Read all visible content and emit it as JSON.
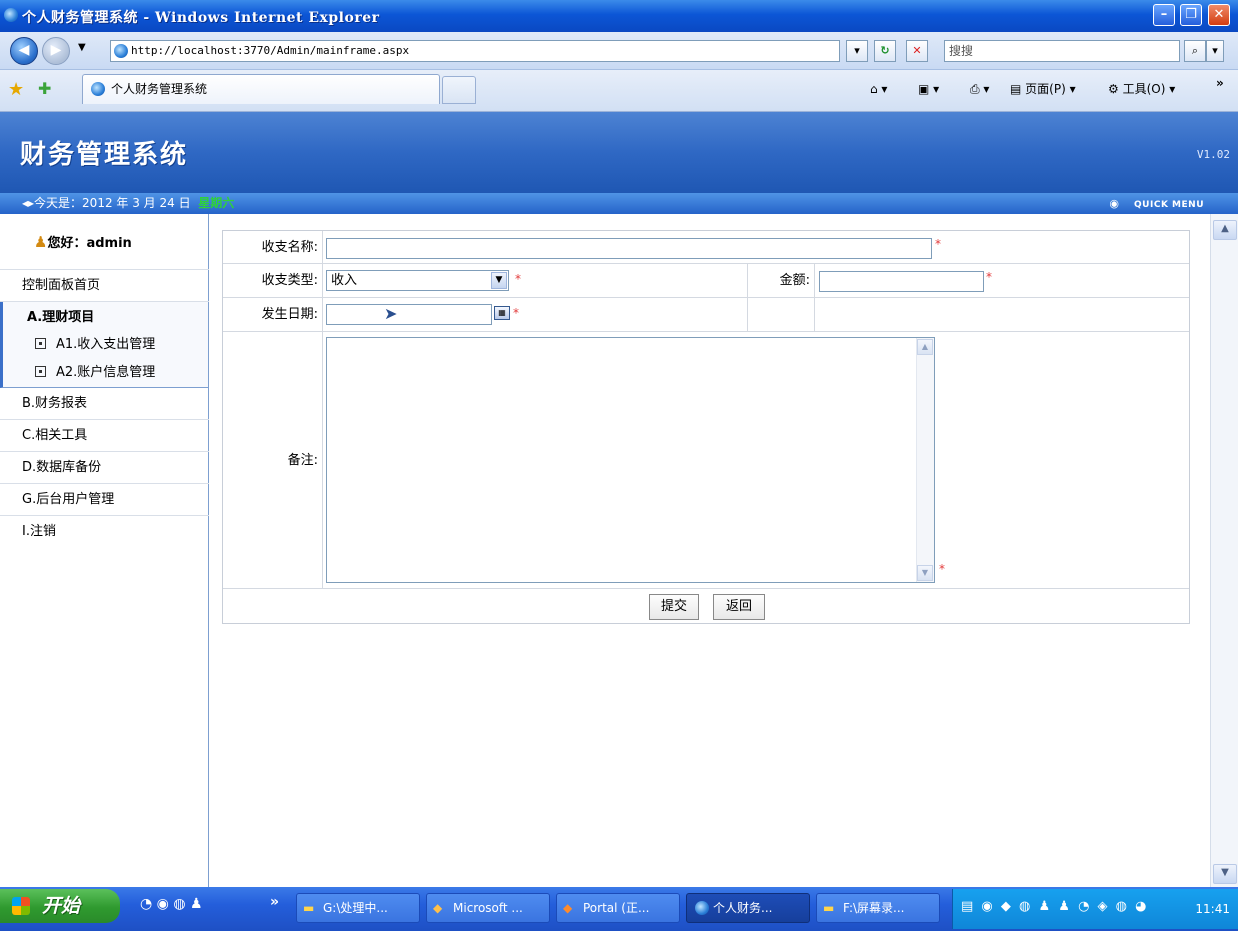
{
  "window": {
    "title": "个人财务管理系统 - Windows Internet Explorer"
  },
  "browser": {
    "url": "http://localhost:3770/Admin/mainframe.aspx",
    "search_placeholder": "搜搜",
    "tab_title": "个人财务管理系统",
    "toolbar": {
      "page": "页面(P)",
      "tools": "工具(O)",
      "more": "»"
    }
  },
  "app": {
    "title": "财务管理系统",
    "version": "V1.02",
    "date_text": "今天是：2012 年 3 月 24 日",
    "weekday": "星期六",
    "quick_menu": "QUICK MENU"
  },
  "sidebar": {
    "greeting": "您好：admin",
    "items": [
      {
        "label": "控制面板首页"
      },
      {
        "label": "A.理财项目"
      },
      {
        "label": "A1.收入支出管理"
      },
      {
        "label": "A2.账户信息管理"
      },
      {
        "label": "B.财务报表"
      },
      {
        "label": "C.相关工具"
      },
      {
        "label": "D.数据库备份"
      },
      {
        "label": "G.后台用户管理"
      },
      {
        "label": "I.注销"
      }
    ]
  },
  "form": {
    "name_label": "收支名称:",
    "name_value": "",
    "type_label": "收支类型:",
    "type_value": "收入",
    "amount_label": "金额:",
    "amount_value": "",
    "date_label": "发生日期:",
    "date_value": "",
    "note_label": "备注:",
    "required_mark": "*",
    "submit_label": "提交",
    "back_label": "返回"
  },
  "taskbar": {
    "start_label": "开始",
    "more": "»",
    "tasks": [
      {
        "label": "G:\\处理中..."
      },
      {
        "label": "Microsoft ..."
      },
      {
        "label": "Portal (正..."
      },
      {
        "label": "个人财务..."
      },
      {
        "label": "F:\\屏幕录..."
      }
    ],
    "clock": "11:41"
  }
}
